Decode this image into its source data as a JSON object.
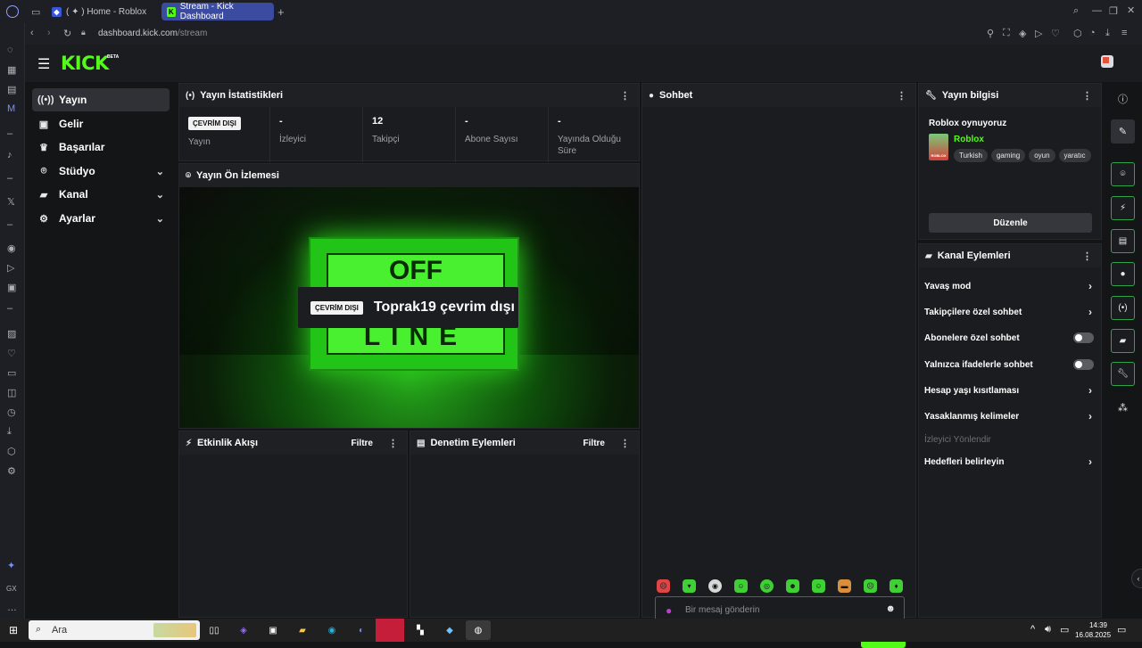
{
  "browser": {
    "tabs": [
      {
        "label": "( ✦ ) Home - Roblox",
        "active": false
      },
      {
        "label": "Stream - Kick Dashboard",
        "active": true
      }
    ],
    "new_tab": "+",
    "url_host": "dashboard.kick.com",
    "url_path": "/stream"
  },
  "header": {
    "logo": "KICK",
    "logo_badge": "BETA"
  },
  "nav": {
    "items": [
      {
        "label": "Yayın",
        "icon": "broadcast-icon",
        "active": true
      },
      {
        "label": "Gelir",
        "icon": "revenue-icon"
      },
      {
        "label": "Başarılar",
        "icon": "trophy-icon"
      },
      {
        "label": "Stüdyo",
        "icon": "studio-icon",
        "expandable": true
      },
      {
        "label": "Kanal",
        "icon": "channel-icon",
        "expandable": true
      },
      {
        "label": "Ayarlar",
        "icon": "gear-icon",
        "expandable": true
      }
    ]
  },
  "stats": {
    "title": "Yayın İstatistikleri",
    "badge": "ÇEVRİM DIŞI",
    "items": [
      {
        "value": "",
        "label": "Yayın"
      },
      {
        "value": "-",
        "label": "İzleyici"
      },
      {
        "value": "12",
        "label": "Takipçi"
      },
      {
        "value": "-",
        "label": "Abone Sayısı"
      },
      {
        "value": "-",
        "label": "Yayında Olduğu Süre"
      }
    ]
  },
  "preview": {
    "title": "Yayın Ön İzlemesi",
    "badge": "ÇEVRİM DIŞI",
    "message": "Toprak19 çevrim dışı",
    "sign_top": "OFF",
    "sign_bottom": "LINE"
  },
  "activity": {
    "title": "Etkinlik Akışı",
    "filter": "Filtre"
  },
  "moderation": {
    "title": "Denetim Eylemleri",
    "filter": "Filtre"
  },
  "chat": {
    "title": "Sohbet",
    "placeholder": "Bir mesaj gönderin",
    "send": "Gönder"
  },
  "stream_info": {
    "title": "Yayın bilgisi",
    "stream_title": "Roblox oynuyoruz",
    "category": "Roblox",
    "thumb_text": "ROBLOX",
    "tags": [
      "Turkish",
      "gaming",
      "oyun",
      "yaratıc"
    ],
    "edit": "Düzenle"
  },
  "channel_actions": {
    "title": "Kanal Eylemleri",
    "items": [
      {
        "label": "Yavaş mod",
        "control": "chevron"
      },
      {
        "label": "Takipçilere özel sohbet",
        "control": "chevron"
      },
      {
        "label": "Abonelere özel sohbet",
        "control": "toggle"
      },
      {
        "label": "Yalnızca ifadelerle sohbet",
        "control": "toggle"
      },
      {
        "label": "Hesap yaşı kısıtlaması",
        "control": "chevron"
      },
      {
        "label": "Yasaklanmış kelimeler",
        "control": "chevron"
      },
      {
        "label": "İzleyici Yönlendir",
        "control": "none",
        "disabled": true
      },
      {
        "label": "Hedefleri belirleyin",
        "control": "chevron"
      }
    ]
  },
  "taskbar": {
    "search": "Ara",
    "time": "14:39",
    "date": "16.08.2025"
  },
  "colors": {
    "accent": "#53fc18",
    "panel": "#1b1c1f",
    "bg": "#141517"
  }
}
